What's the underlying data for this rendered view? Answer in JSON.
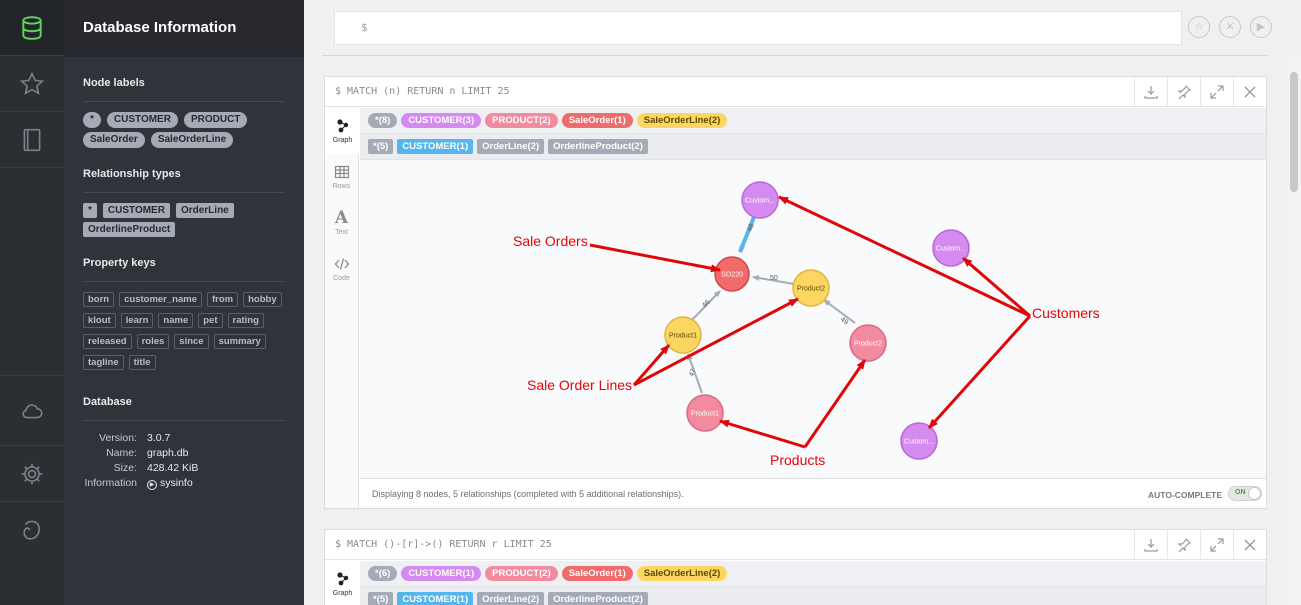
{
  "sidebar": {
    "title": "Database Information",
    "node_labels_title": "Node labels",
    "node_labels": [
      "*",
      "CUSTOMER",
      "PRODUCT",
      "SaleOrder",
      "SaleOrderLine"
    ],
    "rel_types_title": "Relationship types",
    "rel_types": [
      "*",
      "CUSTOMER",
      "OrderLine",
      "OrderlineProduct"
    ],
    "property_keys_title": "Property keys",
    "property_keys": [
      "born",
      "customer_name",
      "from",
      "hobby",
      "klout",
      "learn",
      "name",
      "pet",
      "rating",
      "released",
      "roles",
      "since",
      "summary",
      "tagline",
      "title"
    ],
    "database_title": "Database",
    "database": {
      "version_label": "Version:",
      "version": "3.0.7",
      "name_label": "Name:",
      "name": "graph.db",
      "size_label": "Size:",
      "size": "428.42 KiB",
      "info_label": "Information",
      "info": "sysinfo"
    }
  },
  "editor": {
    "prompt": "$"
  },
  "frame1": {
    "query": "$ MATCH (n) RETURN n LIMIT 25",
    "tabs": [
      "Graph",
      "Rows",
      "Text",
      "Code"
    ],
    "labels": [
      "*(8)",
      "CUSTOMER(3)",
      "PRODUCT(2)",
      "SaleOrder(1)",
      "SaleOrderLine(2)"
    ],
    "rels": [
      "*(5)",
      "CUSTOMER(1)",
      "OrderLine(2)",
      "OrderlineProduct(2)"
    ],
    "status": "Displaying 8 nodes, 5 relationships (completed with 5 additional relationships).",
    "autocomplete_label": "AUTO-COMPLETE",
    "toggle_state": "ON"
  },
  "graph": {
    "nodes": {
      "cust1": "Custom...",
      "cust2": "Custom...",
      "cust3": "Custom...",
      "so": "SO220",
      "line1": "Product1",
      "line2": "Product2",
      "prod1": "Product1",
      "prod2": "Product2"
    },
    "edges": {
      "e1": "48",
      "e2": "50",
      "e3": "46",
      "e4": "49",
      "e5": "47"
    },
    "annotations": {
      "sale_orders": "Sale Orders",
      "customers": "Customers",
      "sale_order_lines": "Sale Order Lines",
      "products": "Products"
    }
  },
  "frame2": {
    "query": "$ MATCH ()-[r]->() RETURN r LIMIT 25",
    "tab": "Graph",
    "labels": [
      "*(6)",
      "CUSTOMER(1)",
      "PRODUCT(2)",
      "SaleOrder(1)",
      "SaleOrderLine(2)"
    ],
    "rels": [
      "*(5)",
      "CUSTOMER(1)",
      "OrderLine(2)",
      "OrderlineProduct(2)"
    ]
  },
  "colors": {
    "customer": "#d58af0",
    "product": "#f28aa0",
    "saleorder": "#f06c6c",
    "saleorderline": "#fcd660",
    "rel_customer": "#55b6ee",
    "rel_gray": "#a5abb6",
    "annotation": "#e0070b"
  }
}
